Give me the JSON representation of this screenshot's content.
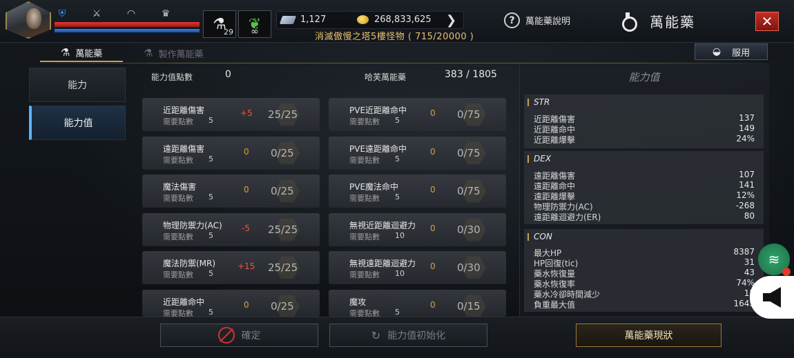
{
  "topbar": {
    "slot1_count": "29",
    "slot2_count": "∞",
    "crystals": "1,127",
    "gold": "268,833,625",
    "quest": "消滅傲慢之塔5樓怪物 ( 715/20000 )",
    "help_label": "萬能藥說明",
    "page_title": "萬能藥",
    "close_label": "✕"
  },
  "tabs": {
    "active_label": "萬能藥",
    "inactive_label": "製作萬能藥",
    "use_label": "服用"
  },
  "nav": {
    "items": [
      {
        "label": "能力"
      },
      {
        "label": "能力值"
      }
    ]
  },
  "points": {
    "label": "能力值點數",
    "value": "0",
    "hafan_label": "哈芙萬能藥",
    "hafan_value": "383 / 1805"
  },
  "left_stats": [
    {
      "name": "近距離傷害",
      "req_label": "需要點數",
      "req": "5",
      "bonus": "+5",
      "progress": "25/25"
    },
    {
      "name": "遠距離傷害",
      "req_label": "需要點數",
      "req": "5",
      "bonus": "0",
      "progress": "0/25"
    },
    {
      "name": "魔法傷害",
      "req_label": "需要點數",
      "req": "5",
      "bonus": "0",
      "progress": "0/25"
    },
    {
      "name": "物理防禦力(AC)",
      "req_label": "需要點數",
      "req": "5",
      "bonus": "-5",
      "progress": "25/25"
    },
    {
      "name": "魔法防禦(MR)",
      "req_label": "需要點數",
      "req": "5",
      "bonus": "+15",
      "progress": "25/25"
    },
    {
      "name": "近距離命中",
      "req_label": "需要點數",
      "req": "5",
      "bonus": "0",
      "progress": "0/25"
    }
  ],
  "right_stats": [
    {
      "name": "PVE近距離命中",
      "req_label": "需要點數",
      "req": "5",
      "bonus": "0",
      "progress": "0/75"
    },
    {
      "name": "PVE遠距離命中",
      "req_label": "需要點數",
      "req": "5",
      "bonus": "0",
      "progress": "0/75"
    },
    {
      "name": "PVE魔法命中",
      "req_label": "需要點數",
      "req": "5",
      "bonus": "0",
      "progress": "0/75"
    },
    {
      "name": "無視近距離迴避力",
      "req_label": "需要點數",
      "req": "10",
      "bonus": "0",
      "progress": "0/30"
    },
    {
      "name": "無視遠距離迴避力",
      "req_label": "需要點數",
      "req": "10",
      "bonus": "0",
      "progress": "0/30"
    },
    {
      "name": "魔攻",
      "req_label": "需要點數",
      "req": "5",
      "bonus": "0",
      "progress": "0/15"
    }
  ],
  "ability_panel": {
    "title": "能力值",
    "groups": [
      {
        "name": "STR",
        "rows": [
          {
            "label": "近距離傷害",
            "value": "137"
          },
          {
            "label": "近距離命中",
            "value": "149"
          },
          {
            "label": "近距離爆擊",
            "value": "24%"
          }
        ]
      },
      {
        "name": "DEX",
        "rows": [
          {
            "label": "遠距離傷害",
            "value": "107"
          },
          {
            "label": "遠距離命中",
            "value": "141"
          },
          {
            "label": "遠距離爆擊",
            "value": "12%"
          },
          {
            "label": "物理防禦力(AC)",
            "value": "-268"
          },
          {
            "label": "遠距離迴避力(ER)",
            "value": "80"
          }
        ]
      },
      {
        "name": "CON",
        "rows": [
          {
            "label": "最大HP",
            "value": "8387"
          },
          {
            "label": "HP回復(tic)",
            "value": "31"
          },
          {
            "label": "藥水恢復量",
            "value": "43"
          },
          {
            "label": "藥水恢復率",
            "value": "74%"
          },
          {
            "label": "藥水冷卻時間減少",
            "value": "15"
          },
          {
            "label": "負重最大值",
            "value": "1645"
          }
        ]
      }
    ]
  },
  "bottom": {
    "confirm_label": "確定",
    "reset_label": "能力值初始化",
    "status_label": "萬能藥現狀"
  },
  "colors": {
    "accent_gold": "#c9a351",
    "hp_red": "#e03a32",
    "mp_blue": "#3f7fd8",
    "active_nav_blue": "#59b3ff",
    "bonus_red": "#ff4a3a",
    "bonus_orange": "#e8a030"
  },
  "icons": [
    "shield-icon",
    "sword-icon",
    "helmet-icon",
    "trophy-icon",
    "potion-slot-icon",
    "leaf-slot-icon",
    "crystal-icon",
    "gold-coin-icon",
    "chevron-right-icon",
    "help-icon",
    "potion-title-icon",
    "close-icon",
    "bowl-icon",
    "no-entry-icon",
    "reset-icon",
    "wifi-icon",
    "speaker-icon"
  ]
}
